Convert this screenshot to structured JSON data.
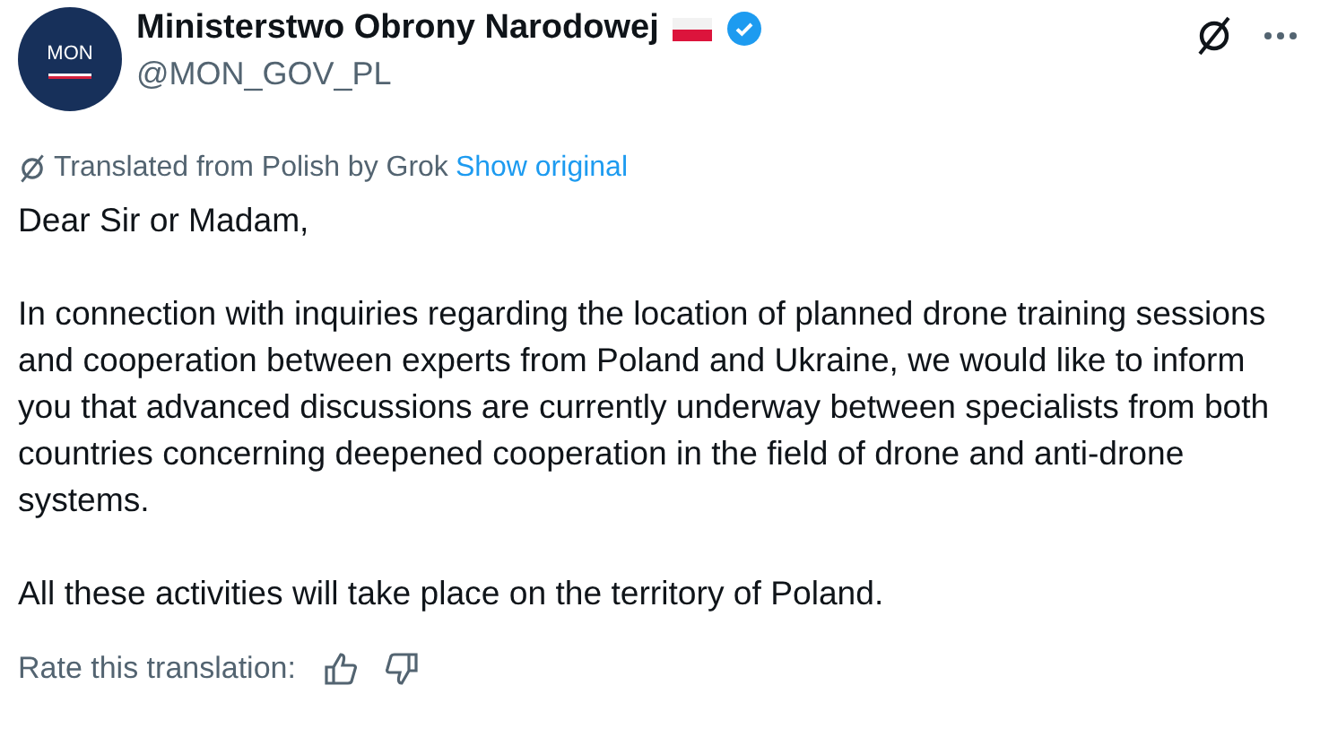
{
  "author": {
    "avatar_text": "MON",
    "name": "Ministerstwo Obrony Narodowej",
    "verified": true,
    "handle": "@MON_GOV_PL"
  },
  "translation": {
    "note": "Translated from Polish by Grok",
    "link": "Show original"
  },
  "paragraphs": [
    "Dear Sir or Madam,",
    "In connection with inquiries regarding the location of planned drone training sessions and cooperation between experts from Poland and Ukraine, we would like to inform you that advanced discussions are currently underway between specialists from both countries concerning deepened cooperation in the field of drone and anti-drone systems.",
    "All these activities will take place on the territory of Poland."
  ],
  "rating": {
    "label": "Rate this translation:"
  }
}
